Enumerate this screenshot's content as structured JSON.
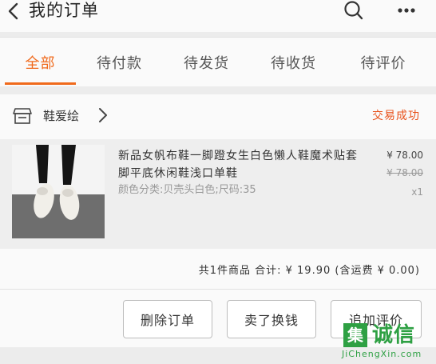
{
  "header": {
    "title": "我的订单",
    "back_icon": "chevron-left-icon",
    "search_icon": "search-icon",
    "more_icon": "more-dots-icon"
  },
  "tabs": [
    {
      "label": "全部",
      "active": true
    },
    {
      "label": "待付款",
      "active": false
    },
    {
      "label": "待发货",
      "active": false
    },
    {
      "label": "待收货",
      "active": false
    },
    {
      "label": "待评价",
      "active": false
    }
  ],
  "order": {
    "shop_name": "鞋爱绘",
    "shop_icon": "store-icon",
    "status": "交易成功",
    "item": {
      "name": "新品女帆布鞋一脚蹬女生白色懒人鞋魔术贴套脚平底休闲鞋浅口单鞋",
      "variant": "颜色分类:贝壳头白色;尺码:35",
      "price": "¥ 78.00",
      "original_price": "¥ 78.00",
      "quantity": "x1"
    },
    "summary": "共1件商品  合计: ¥ 19.90 (含运费 ¥ 0.00)",
    "buttons": {
      "delete": "删除订单",
      "sell": "卖了换钱",
      "review": "追加评价"
    }
  },
  "watermark": {
    "box_char": "集",
    "text": "诚信",
    "url": "JiChengXin.com"
  },
  "colors": {
    "accent": "#f06a1c",
    "status": "#e8531c",
    "watermark": "#2ea043"
  }
}
